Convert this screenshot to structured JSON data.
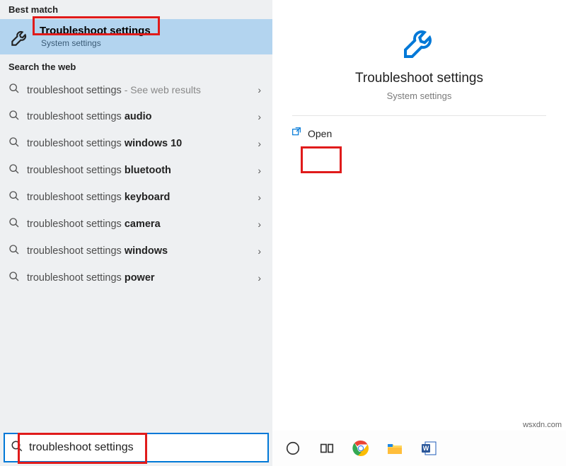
{
  "sections": {
    "best_match_header": "Best match",
    "search_web_header": "Search the web"
  },
  "best_match": {
    "title": "Troubleshoot settings",
    "subtitle": "System settings"
  },
  "web_results": [
    {
      "prefix": "troubleshoot settings",
      "bold": "",
      "hint": " - See web results"
    },
    {
      "prefix": "troubleshoot settings ",
      "bold": "audio",
      "hint": ""
    },
    {
      "prefix": "troubleshoot settings ",
      "bold": "windows 10",
      "hint": ""
    },
    {
      "prefix": "troubleshoot settings ",
      "bold": "bluetooth",
      "hint": ""
    },
    {
      "prefix": "troubleshoot settings ",
      "bold": "keyboard",
      "hint": ""
    },
    {
      "prefix": "troubleshoot settings ",
      "bold": "camera",
      "hint": ""
    },
    {
      "prefix": "troubleshoot settings ",
      "bold": "windows",
      "hint": ""
    },
    {
      "prefix": "troubleshoot settings ",
      "bold": "power",
      "hint": ""
    }
  ],
  "search": {
    "value": "troubleshoot settings"
  },
  "preview": {
    "title": "Troubleshoot settings",
    "subtitle": "System settings",
    "open_label": "Open"
  },
  "watermark": "wsxdn.com",
  "colors": {
    "selected_bg": "#b3d4ef",
    "accent": "#0078d7",
    "highlight": "#e01b1b"
  }
}
